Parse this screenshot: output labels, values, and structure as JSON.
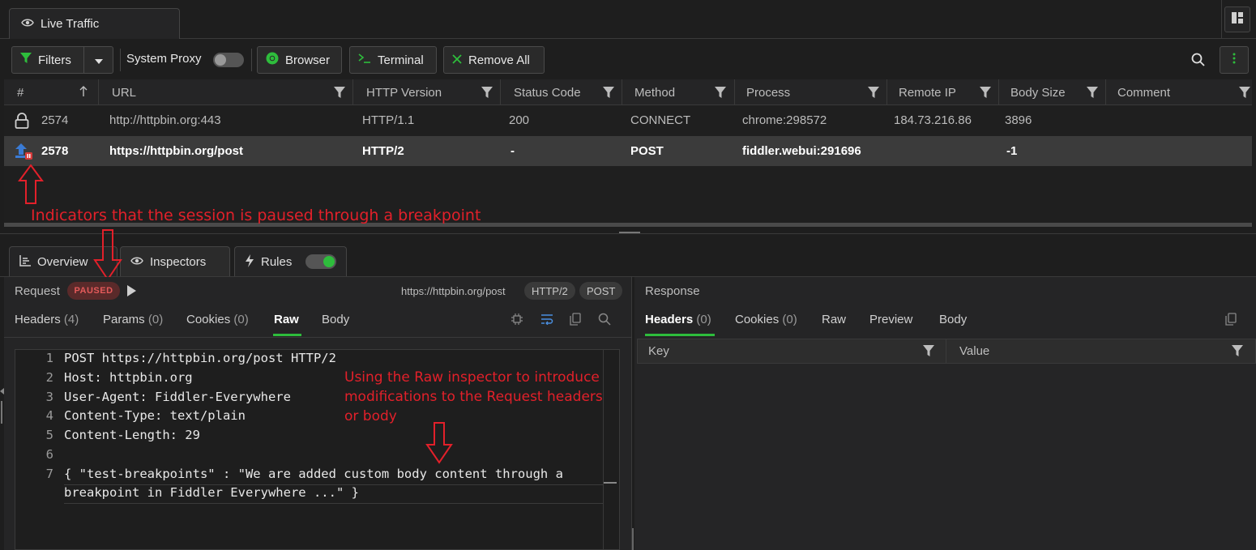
{
  "top_tab": {
    "label": "Live Traffic"
  },
  "toolbar": {
    "filters": "Filters",
    "system_proxy": "System Proxy",
    "browser": "Browser",
    "terminal": "Terminal",
    "remove_all": "Remove All"
  },
  "grid": {
    "columns": [
      "#",
      "URL",
      "HTTP Version",
      "Status Code",
      "Method",
      "Process",
      "Remote IP",
      "Body Size",
      "Comment"
    ],
    "rows": [
      {
        "id": "2574",
        "url": "http://httpbin.org:443",
        "http_version": "HTTP/1.1",
        "status": "200",
        "method": "CONNECT",
        "process": "chrome:298572",
        "remote_ip": "184.73.216.86",
        "body_size": "3896",
        "comment": ""
      },
      {
        "id": "2578",
        "url": "https://httpbin.org/post",
        "http_version": "HTTP/2",
        "status": "-",
        "method": "POST",
        "process": "fiddler.webui:291696",
        "remote_ip": "",
        "body_size": "-1",
        "comment": ""
      }
    ]
  },
  "annotations": {
    "paused_indicator": "Indicators that the session is paused through a breakpoint",
    "raw_inspector_1": "Using the Raw inspector to introduce",
    "raw_inspector_2": "modifications to the Request headers",
    "raw_inspector_3": "or body"
  },
  "bottom_tabs": {
    "overview": "Overview",
    "inspectors": "Inspectors",
    "rules": "Rules"
  },
  "request": {
    "title": "Request",
    "badge": "PAUSED",
    "url": "https://httpbin.org/post",
    "protocol": "HTTP/2",
    "method": "POST",
    "tabs": [
      {
        "label": "Headers",
        "count": "(4)"
      },
      {
        "label": "Params",
        "count": "(0)"
      },
      {
        "label": "Cookies",
        "count": "(0)"
      },
      {
        "label": "Raw",
        "count": ""
      },
      {
        "label": "Body",
        "count": ""
      }
    ],
    "raw_lines": [
      {
        "n": "1",
        "text": "POST https://httpbin.org/post HTTP/2"
      },
      {
        "n": "2",
        "text": "Host: httpbin.org"
      },
      {
        "n": "3",
        "text": "User-Agent: Fiddler-Everywhere"
      },
      {
        "n": "4",
        "text": "Content-Type: text/plain"
      },
      {
        "n": "5",
        "text": "Content-Length: 29"
      },
      {
        "n": "6",
        "text": ""
      },
      {
        "n": "7",
        "text": "{ \"test-breakpoints\" : \"We are added custom body content through a"
      },
      {
        "n": "",
        "text": "breakpoint in Fiddler Everywhere ...\" }"
      }
    ]
  },
  "response": {
    "title": "Response",
    "tabs": [
      {
        "label": "Headers",
        "count": "(0)"
      },
      {
        "label": "Cookies",
        "count": "(0)"
      },
      {
        "label": "Raw",
        "count": ""
      },
      {
        "label": "Preview",
        "count": ""
      },
      {
        "label": "Body",
        "count": ""
      }
    ],
    "columns": [
      "Key",
      "Value"
    ]
  },
  "colors": {
    "accent_green": "#2ebd3c",
    "annotation_red": "#e2202a",
    "paused_red": "#e35a5a"
  }
}
